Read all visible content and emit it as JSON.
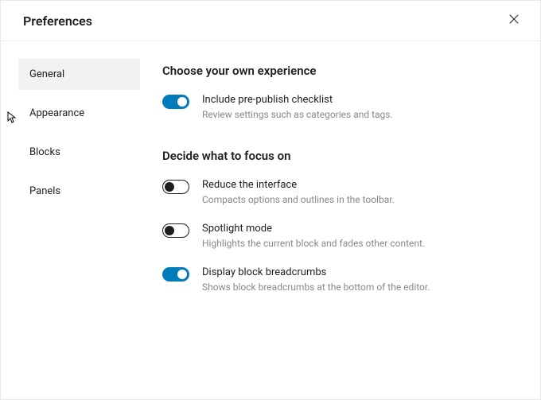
{
  "title": "Preferences",
  "sidebar": {
    "items": [
      {
        "label": "General",
        "active": true
      },
      {
        "label": "Appearance",
        "active": false
      },
      {
        "label": "Blocks",
        "active": false
      },
      {
        "label": "Panels",
        "active": false
      }
    ]
  },
  "sections": [
    {
      "heading": "Choose your own experience",
      "options": [
        {
          "label": "Include pre-publish checklist",
          "desc": "Review settings such as categories and tags.",
          "on": true
        }
      ]
    },
    {
      "heading": "Decide what to focus on",
      "options": [
        {
          "label": "Reduce the interface",
          "desc": "Compacts options and outlines in the toolbar.",
          "on": false
        },
        {
          "label": "Spotlight mode",
          "desc": "Highlights the current block and fades other content.",
          "on": false
        },
        {
          "label": "Display block breadcrumbs",
          "desc": "Shows block breadcrumbs at the bottom of the editor.",
          "on": true
        }
      ]
    }
  ]
}
